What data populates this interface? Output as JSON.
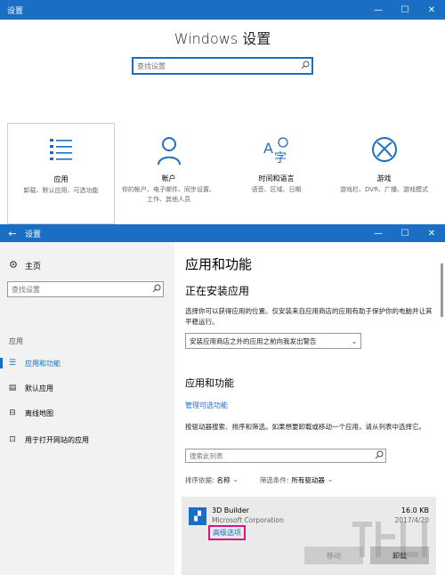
{
  "top_window": {
    "titlebar": {
      "title": "设置",
      "minimize": "—",
      "maximize": "☐",
      "close": "✕"
    },
    "heading": "Windows 设置",
    "search": {
      "placeholder": "查找设置",
      "icon": "search-icon"
    },
    "categories": [
      {
        "name": "应用",
        "desc": "卸载、默认应用、可选功能",
        "icon": "apps-list-icon"
      },
      {
        "name": "帐户",
        "desc": "你的帐户、电子邮件、同步设置、工作、其他人员",
        "icon": "person-icon"
      },
      {
        "name": "时间和语言",
        "desc": "语音、区域、日期",
        "icon": "time-language-icon"
      },
      {
        "name": "游戏",
        "desc": "游戏栏、DVR、广播、游戏模式",
        "icon": "xbox-icon"
      }
    ]
  },
  "bottom_window": {
    "titlebar": {
      "back": "←",
      "title": "设置",
      "minimize": "—",
      "maximize": "☐",
      "close": "✕"
    },
    "sidebar": {
      "home": "主页",
      "search_placeholder": "查找设置",
      "section": "应用",
      "items": [
        {
          "label": "应用和功能",
          "icon": "apps-features-icon",
          "active": true
        },
        {
          "label": "默认应用",
          "icon": "default-apps-icon",
          "active": false
        },
        {
          "label": "离线地图",
          "icon": "offline-maps-icon",
          "active": false
        },
        {
          "label": "用于打开网站的应用",
          "icon": "website-apps-icon",
          "active": false
        }
      ]
    },
    "main": {
      "title": "应用和功能",
      "installing_heading": "正在安装应用",
      "installing_desc": "选择你可以获得应用的位置。仅安装来自应用商店的应用有助于保护你的电脑并让其平稳运行。",
      "install_source_value": "安装应用商店之外的应用之前向我发出警告",
      "apps_heading": "应用和功能",
      "manage_optional_link": "管理可选功能",
      "apps_desc": "按驱动器搜索、排序和筛选。如果想要卸载或移动一个应用，请从列表中选择它。",
      "list_search_placeholder": "搜索此列表",
      "sort_label": "排序依据:",
      "sort_value": "名称",
      "filter_label": "筛选条件:",
      "filter_value": "所有驱动器",
      "app": {
        "name": "3D Builder",
        "publisher": "Microsoft Corporation",
        "size": "16.0 KB",
        "date": "2017/4/20",
        "advanced_link": "高级选项",
        "move_button": "移动",
        "uninstall_button": "卸载"
      }
    }
  },
  "colors": {
    "accent": "#1a6fc4",
    "highlight_border": "#d6167a",
    "sidebar_bg": "#f2f2f2"
  }
}
